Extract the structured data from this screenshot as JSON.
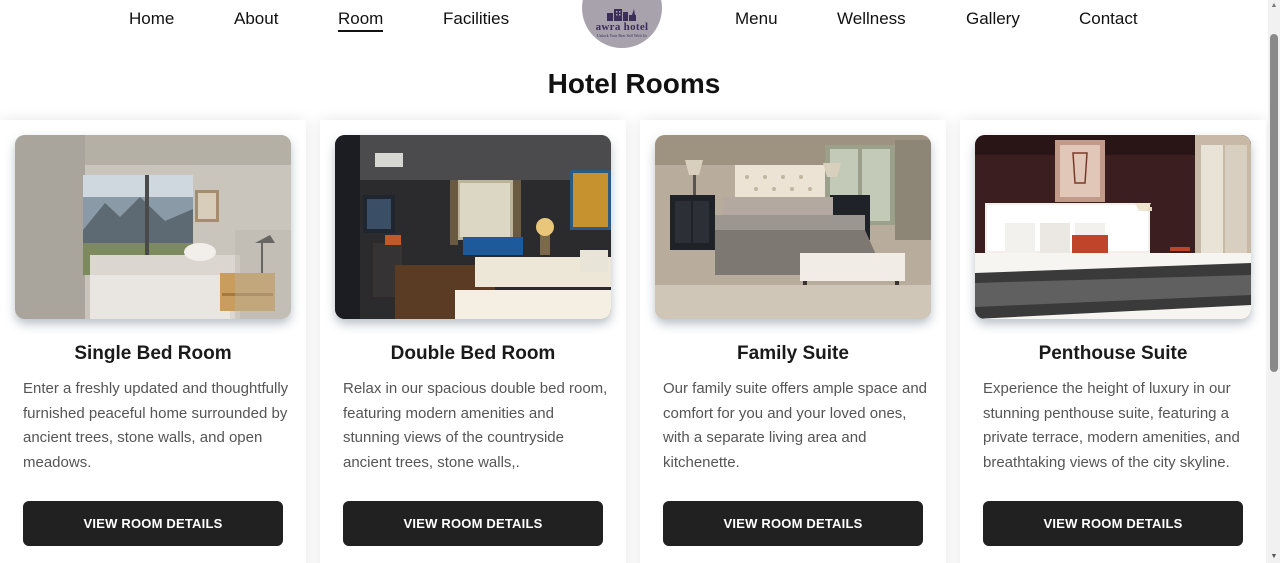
{
  "nav": {
    "items": [
      {
        "label": "Home"
      },
      {
        "label": "About"
      },
      {
        "label": "Room"
      },
      {
        "label": "Facilities"
      },
      {
        "label": "Menu"
      },
      {
        "label": "Wellness"
      },
      {
        "label": "Gallery"
      },
      {
        "label": "Contact"
      }
    ],
    "active": "Room"
  },
  "logo": {
    "name": "awra hotel",
    "tagline": "Unlock Your Best Self With Us"
  },
  "page_title": "Hotel Rooms",
  "rooms": [
    {
      "title": "Single Bed Room",
      "description": "Enter a freshly updated and thoughtfully furnished peaceful home surrounded by ancient trees, stone walls, and open meadows.",
      "button_label": "VIEW ROOM DETAILS",
      "photo": "single-bed-room-photo"
    },
    {
      "title": "Double Bed Room",
      "description": "Relax in our spacious double bed room, featuring modern amenities and stunning views of the countryside ancient trees, stone walls,.",
      "button_label": "VIEW ROOM DETAILS",
      "photo": "double-bed-room-photo"
    },
    {
      "title": "Family Suite",
      "description": "Our family suite offers ample space and comfort for you and your loved ones, with a separate living area and kitchenette.",
      "button_label": "VIEW ROOM DETAILS",
      "photo": "family-suite-photo"
    },
    {
      "title": "Penthouse Suite",
      "description": "Experience the height of luxury in our stunning penthouse suite, featuring a private terrace, modern amenities, and breathtaking views of the city skyline.",
      "button_label": "VIEW ROOM DETAILS",
      "photo": "penthouse-suite-photo"
    }
  ],
  "colors": {
    "button_bg": "#212121",
    "button_text": "#ffffff",
    "logo_bg": "#a8a2ad",
    "logo_text": "#3b2e5a",
    "body_text": "#555555"
  }
}
